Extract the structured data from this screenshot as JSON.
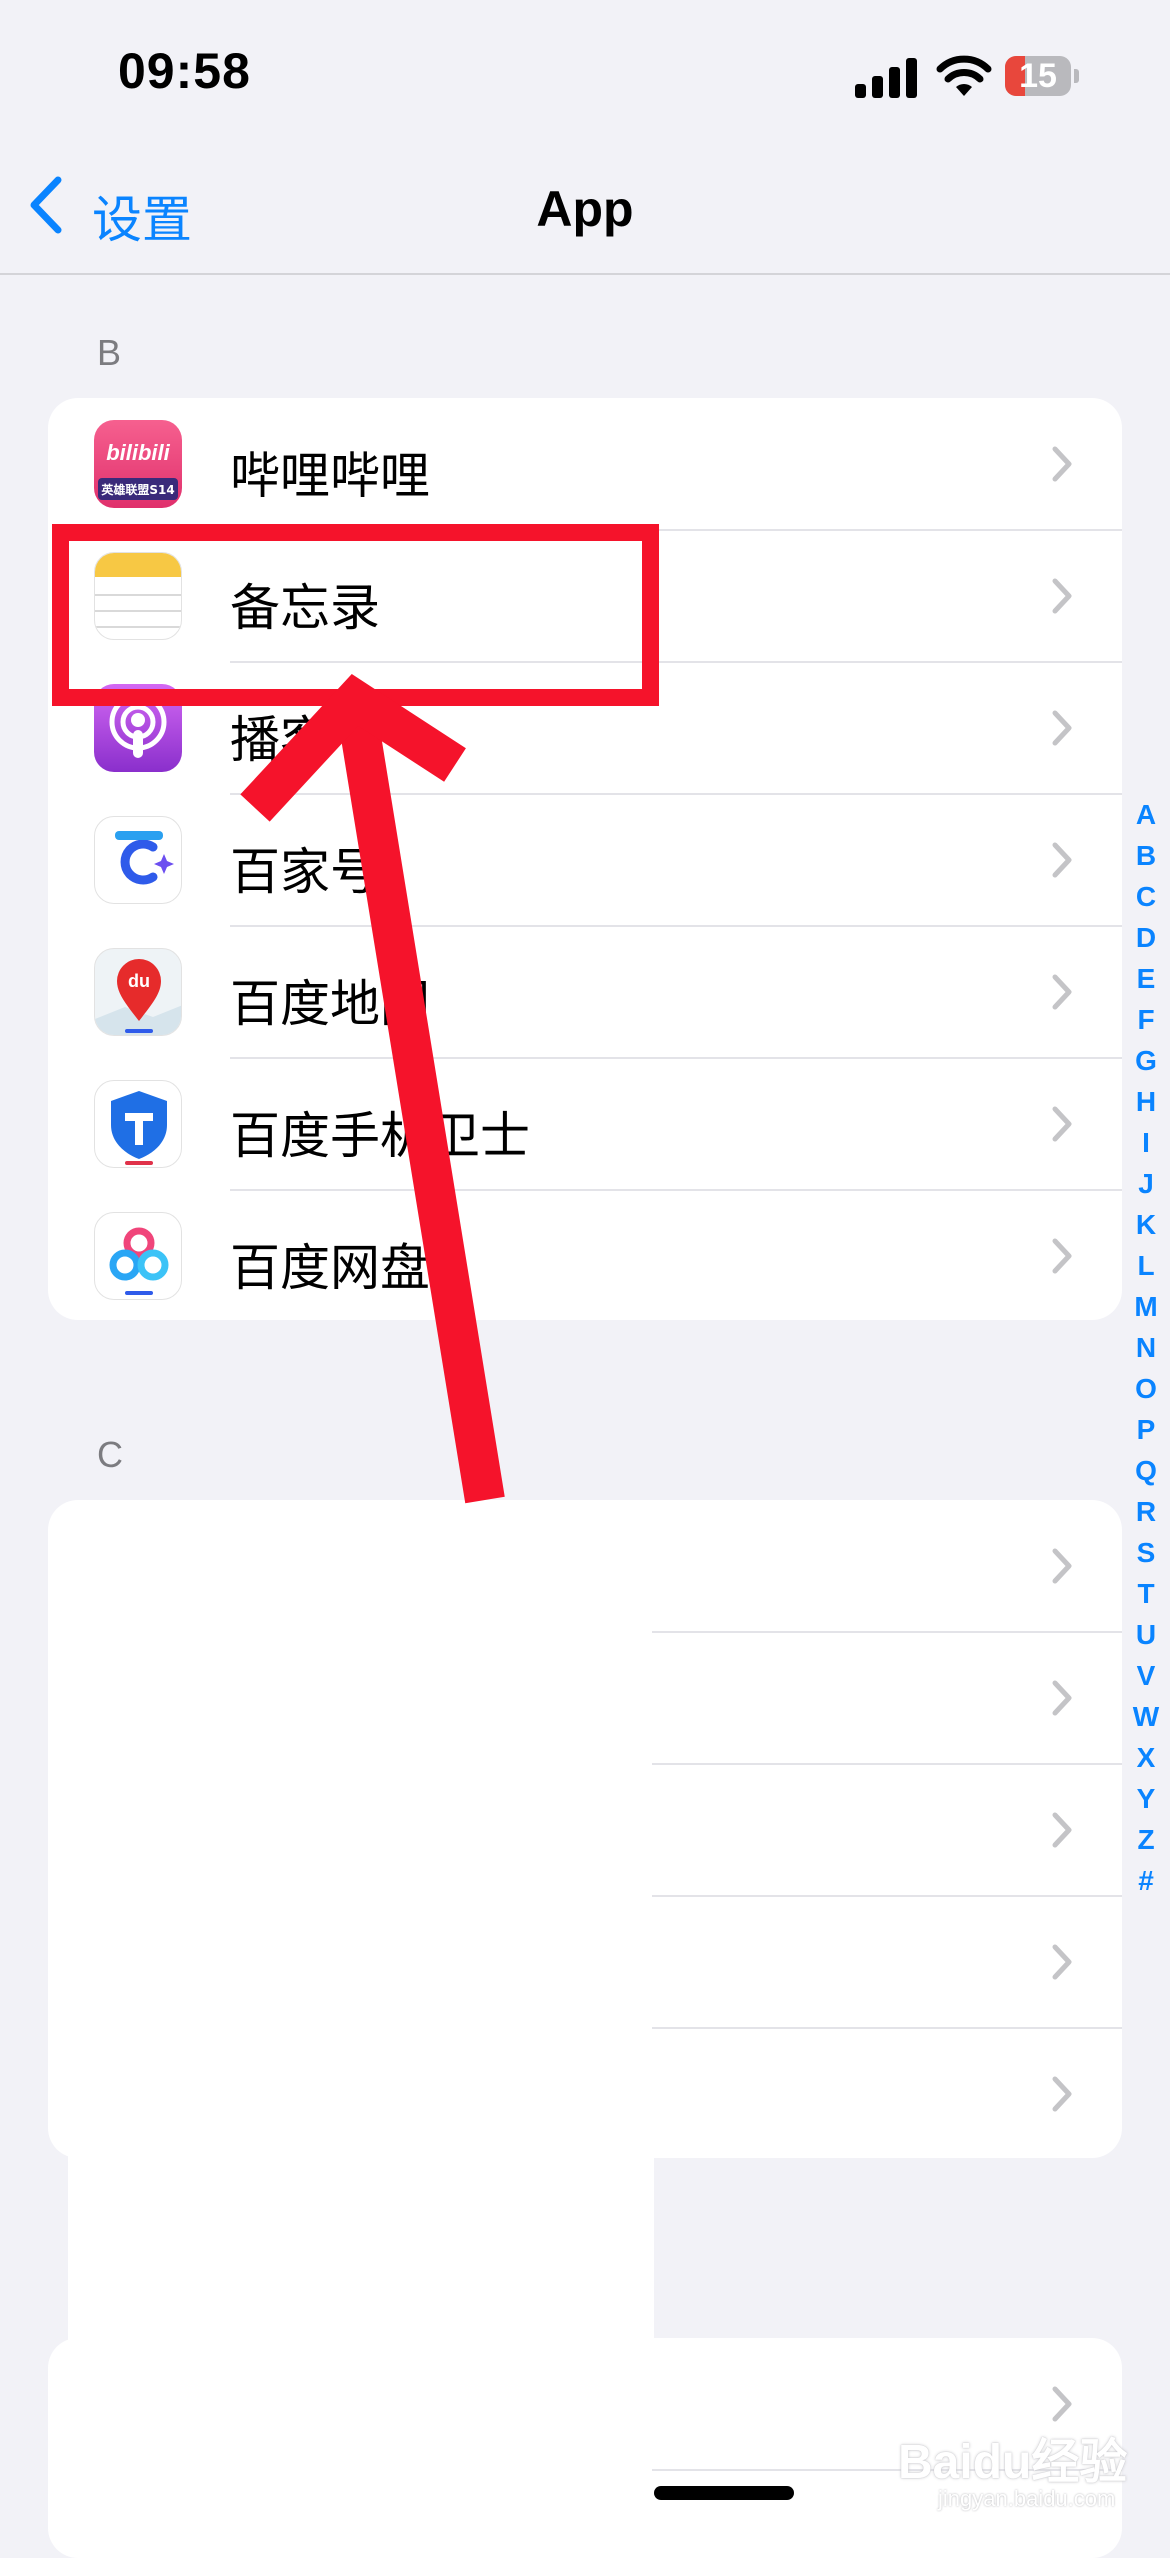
{
  "status_bar": {
    "time": "09:58",
    "battery": "15",
    "battery_level": 0.15
  },
  "nav": {
    "back_label": "设置",
    "title": "App"
  },
  "section_b": {
    "header": "B",
    "items": [
      {
        "label": "哔哩哔哩",
        "icon": "bilibili-app-icon",
        "icon_caption": "英雄联盟S14"
      },
      {
        "label": "备忘录",
        "icon": "notes-app-icon"
      },
      {
        "label": "播客",
        "icon": "podcasts-app-icon"
      },
      {
        "label": "百家号",
        "icon": "baijiahao-app-icon"
      },
      {
        "label": "百度地图",
        "icon": "baidu-maps-app-icon"
      },
      {
        "label": "百度手机卫士",
        "icon": "baidu-security-app-icon"
      },
      {
        "label": "百度网盘",
        "icon": "baidu-netdisk-app-icon"
      }
    ]
  },
  "section_c": {
    "header": "C"
  },
  "index_letters": [
    "A",
    "B",
    "C",
    "D",
    "E",
    "F",
    "G",
    "H",
    "I",
    "J",
    "K",
    "L",
    "M",
    "N",
    "O",
    "P",
    "Q",
    "R",
    "S",
    "T",
    "U",
    "V",
    "W",
    "X",
    "Y",
    "Z",
    "#"
  ],
  "watermark": {
    "brand": "Baidu经验",
    "url": "jingyan.baidu.com"
  },
  "colors": {
    "accent": "#0a84ff",
    "annotation": "#f5132b",
    "background": "#f2f2f7"
  }
}
